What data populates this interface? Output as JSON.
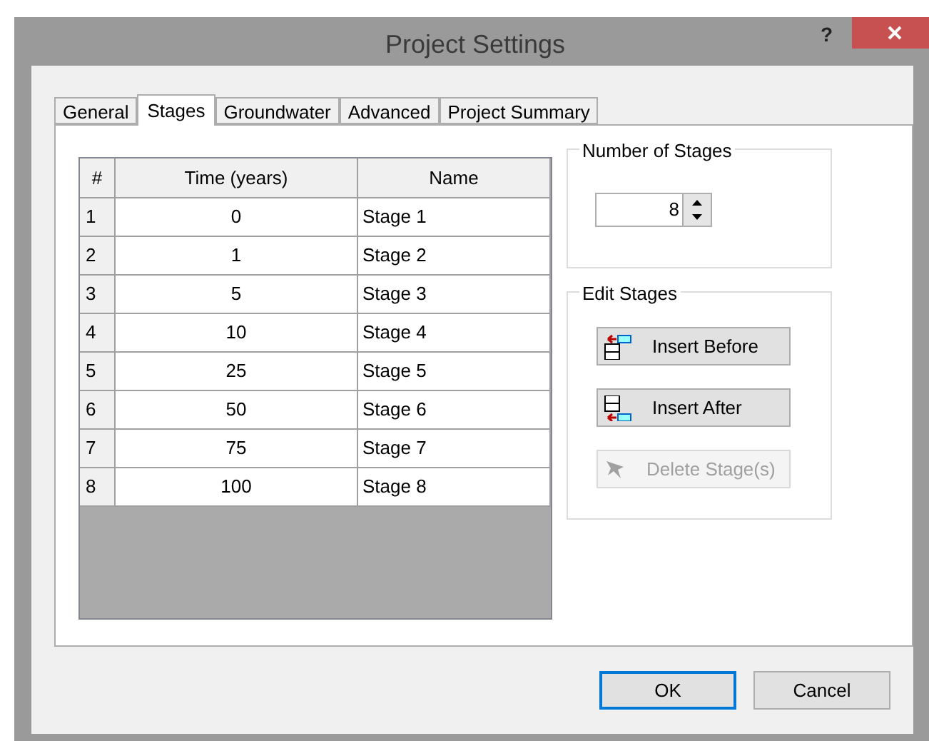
{
  "window": {
    "title": "Project Settings",
    "help": "?"
  },
  "tabs": [
    {
      "label": "General",
      "selected": false
    },
    {
      "label": "Stages",
      "selected": true
    },
    {
      "label": "Groundwater",
      "selected": false
    },
    {
      "label": "Advanced",
      "selected": false
    },
    {
      "label": "Project Summary",
      "selected": false
    }
  ],
  "table": {
    "columns": [
      "#",
      "Time (years)",
      "Name"
    ],
    "rows": [
      [
        "1",
        "0",
        "Stage 1"
      ],
      [
        "2",
        "1",
        "Stage 2"
      ],
      [
        "3",
        "5",
        "Stage 3"
      ],
      [
        "4",
        "10",
        "Stage 4"
      ],
      [
        "5",
        "25",
        "Stage 5"
      ],
      [
        "6",
        "50",
        "Stage 6"
      ],
      [
        "7",
        "75",
        "Stage 7"
      ],
      [
        "8",
        "100",
        "Stage 8"
      ]
    ]
  },
  "number_of_stages": {
    "title": "Number of Stages",
    "value": "8"
  },
  "edit_stages": {
    "title": "Edit Stages",
    "buttons": [
      {
        "label": "Insert Before",
        "kind": "before",
        "disabled": false
      },
      {
        "label": "Insert After",
        "kind": "after",
        "disabled": false
      },
      {
        "label": "Delete Stage(s)",
        "kind": "delete",
        "disabled": true
      }
    ]
  },
  "buttons": [
    {
      "label": "OK",
      "default": true
    },
    {
      "label": "Cancel",
      "default": false
    }
  ]
}
